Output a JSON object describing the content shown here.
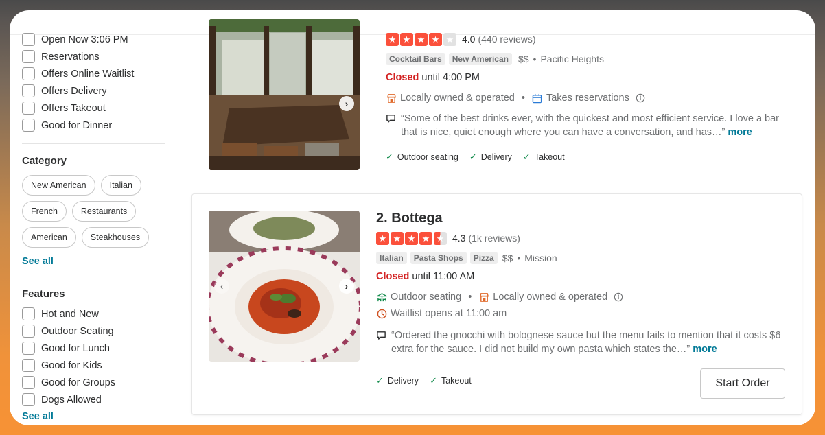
{
  "sidebar": {
    "top_filters": [
      "Open Now 3:06 PM",
      "Reservations",
      "Offers Online Waitlist",
      "Offers Delivery",
      "Offers Takeout",
      "Good for Dinner"
    ],
    "category": {
      "title": "Category",
      "pills": [
        "New American",
        "Italian",
        "French",
        "Restaurants",
        "American",
        "Steakhouses"
      ],
      "see_all": "See all"
    },
    "features": {
      "title": "Features",
      "items": [
        "Hot and New",
        "Outdoor Seating",
        "Good for Lunch",
        "Good for Kids",
        "Good for Groups",
        "Dogs Allowed"
      ],
      "see_all": "See all"
    }
  },
  "results": [
    {
      "name": "",
      "rating_stars": 4.0,
      "rating": "4.0",
      "reviews": "(440 reviews)",
      "tags": [
        "Cocktail Bars",
        "New American"
      ],
      "price": "$$",
      "neighborhood": "Pacific Heights",
      "closed_label": "Closed",
      "closed_until": "until 4:00 PM",
      "attrs": [
        "Locally owned & operated",
        "Takes reservations"
      ],
      "snippet": "“Some of the best drinks ever, with the quickest and most efficient service. I love a bar that is nice, quiet enough where you can have a conversation, and has…”",
      "more": "more",
      "amenities": [
        "Outdoor seating",
        "Delivery",
        "Takeout"
      ]
    },
    {
      "name": "2. Bottega",
      "rating_stars": 4.5,
      "rating": "4.3",
      "reviews": "(1k reviews)",
      "tags": [
        "Italian",
        "Pasta Shops",
        "Pizza"
      ],
      "price": "$$",
      "neighborhood": "Mission",
      "closed_label": "Closed",
      "closed_until": "until 11:00 AM",
      "attrs": [
        "Outdoor seating",
        "Locally owned & operated"
      ],
      "waitlist": "Waitlist opens at 11:00 am",
      "snippet": "“Ordered the gnocchi with bolognese sauce but the menu fails to mention that it costs $6 extra for the sauce. I did not build my own pasta which states the…”",
      "more": "more",
      "amenities": [
        "Delivery",
        "Takeout"
      ],
      "start_order": "Start Order"
    }
  ],
  "colors": {
    "star_red": "#fb503b",
    "closed_red": "#d32323",
    "link_teal": "#027a97",
    "check_green": "#108a4a"
  }
}
